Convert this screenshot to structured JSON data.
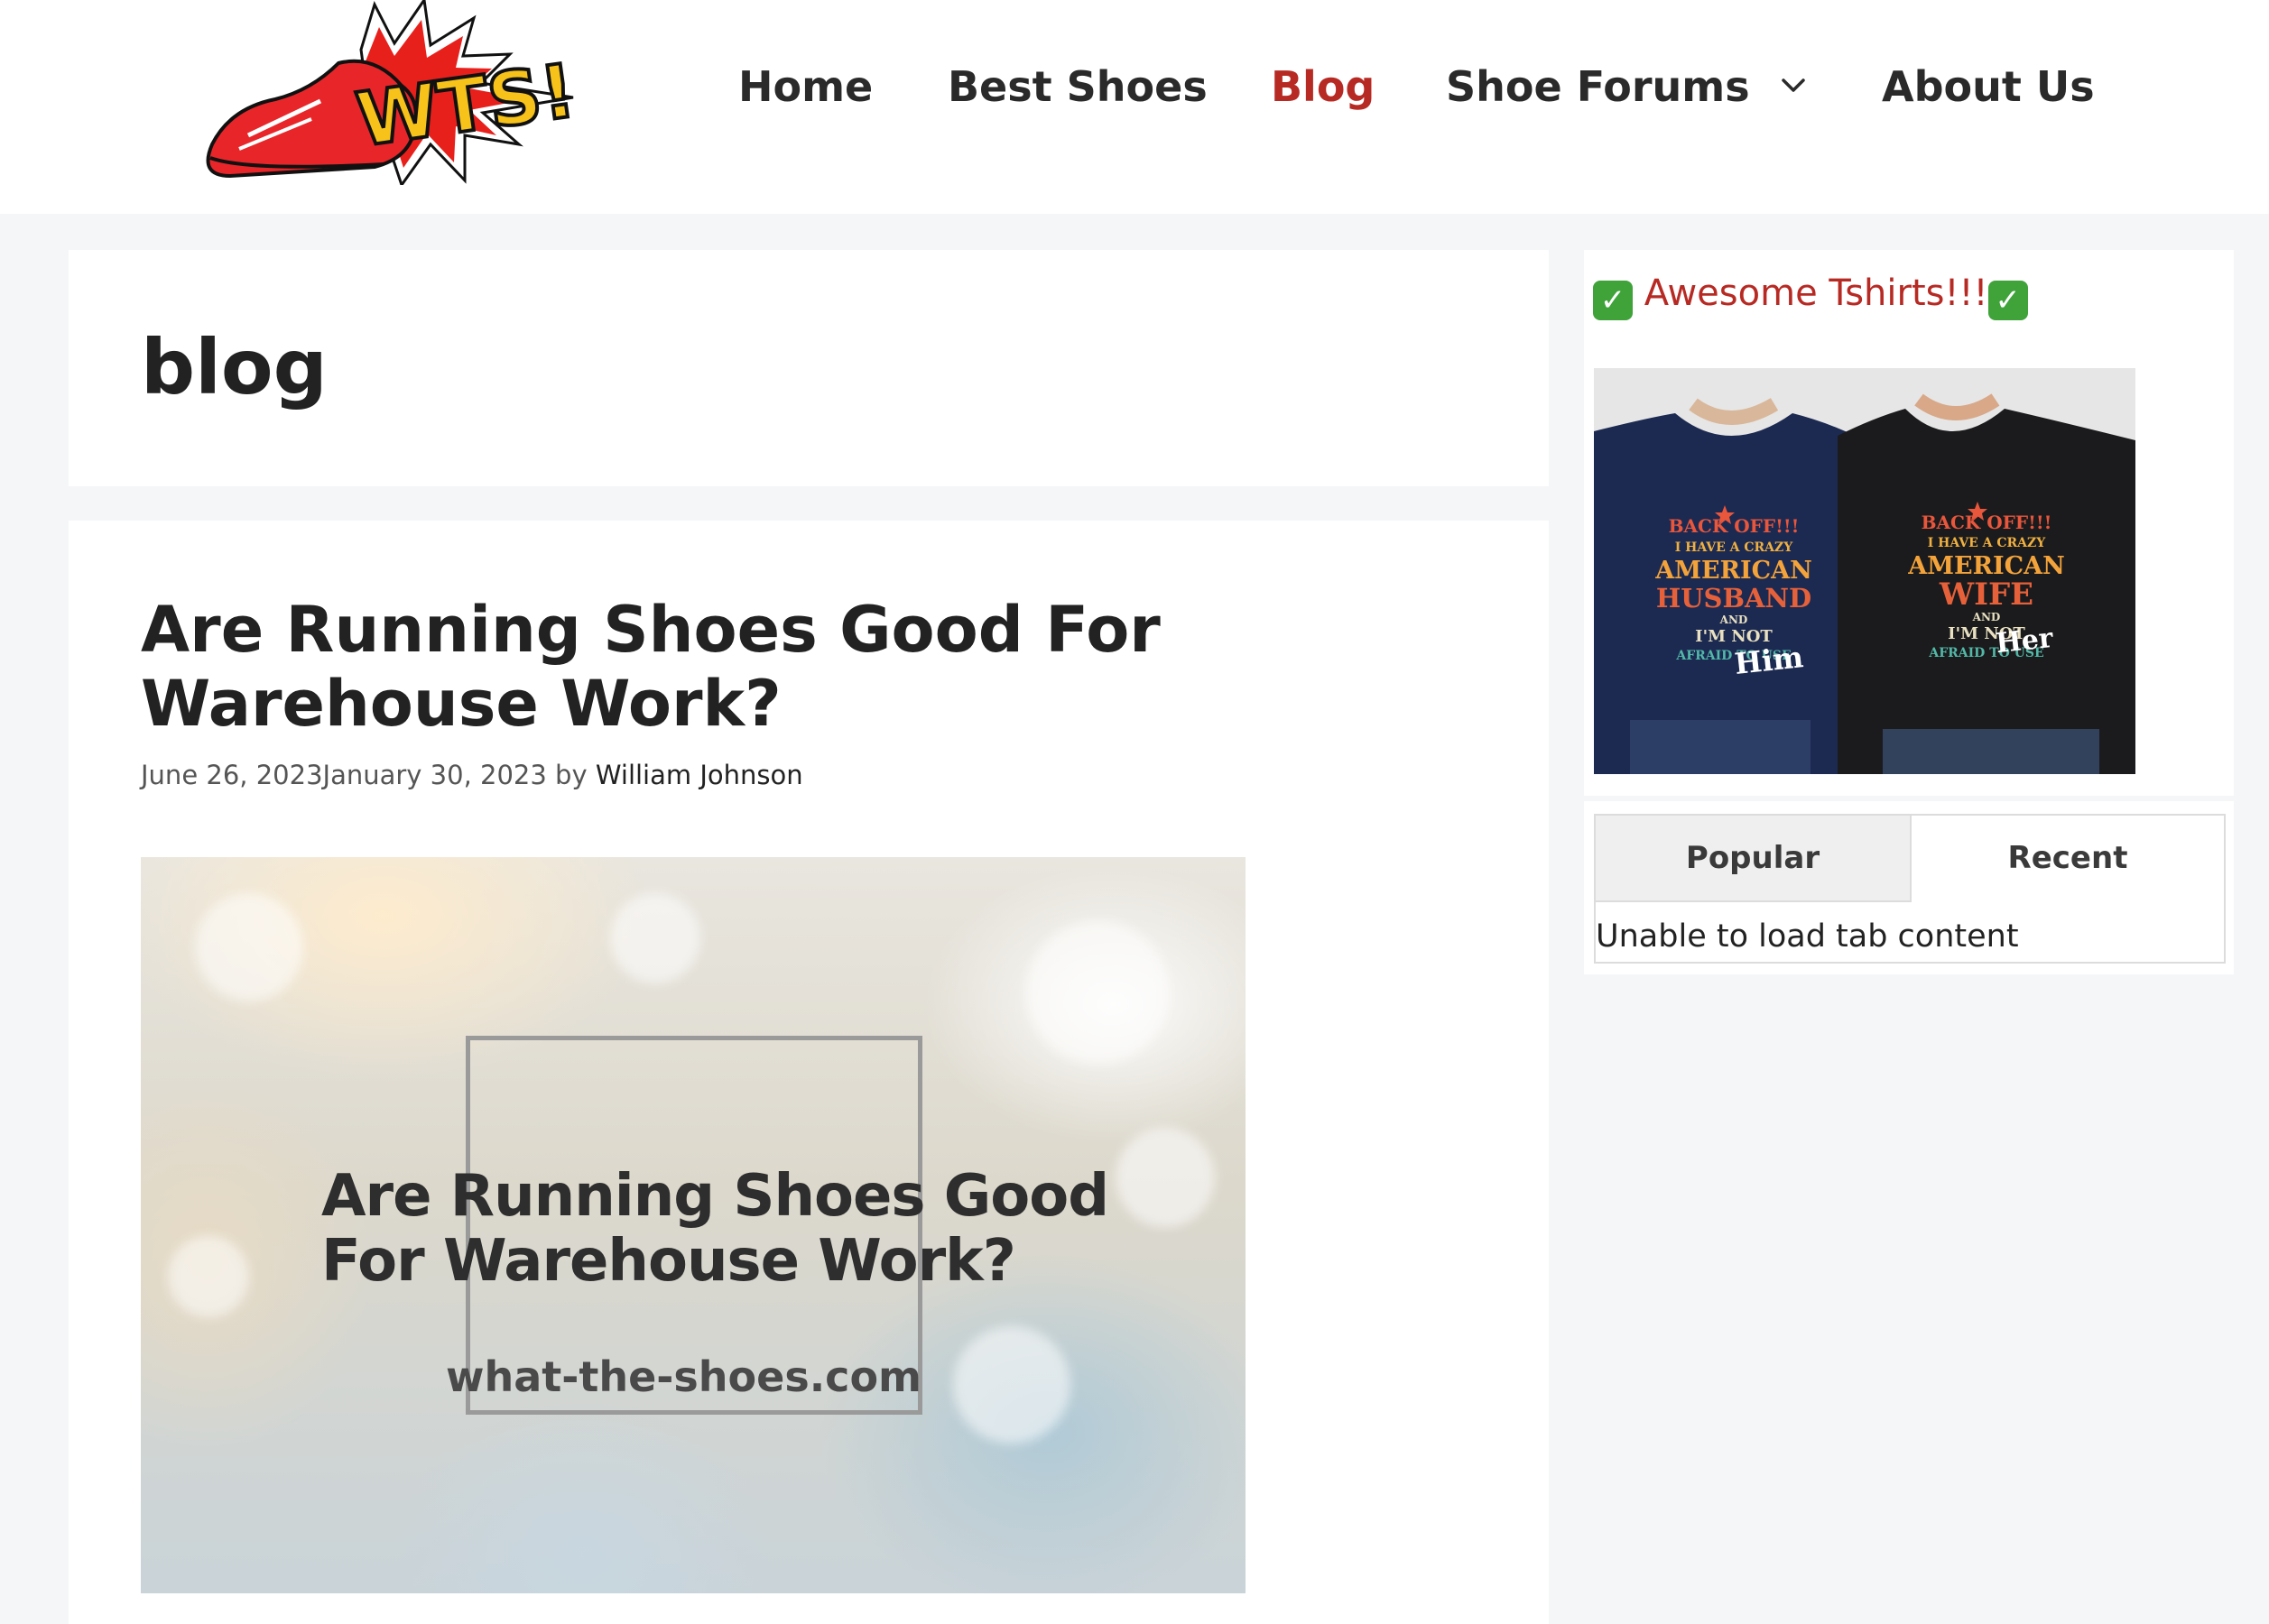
{
  "header": {
    "logo_text": "WTS!",
    "nav": [
      {
        "label": "Home"
      },
      {
        "label": "Best Shoes"
      },
      {
        "label": "Blog",
        "active": true
      },
      {
        "label": "Shoe Forums",
        "has_dropdown": true
      },
      {
        "label": "About Us"
      }
    ],
    "dropdown_icon": "chevron-down-icon"
  },
  "archive": {
    "title": "blog"
  },
  "post": {
    "title": "Are Running Shoes Good For Warehouse Work?",
    "published": "June 26, 2023",
    "updated": "January 30, 2023",
    "by": "by",
    "author": "William Johnson",
    "featured_image": {
      "headline": "Are Running Shoes Good For Warehouse Work?",
      "domain": "what-the-shoes.com"
    }
  },
  "sidebar": {
    "ad": {
      "heading": "Awesome Tshirts!!!",
      "check_icon": "check-icon",
      "shirts": [
        {
          "lines": [
            "BACK OFF!!!",
            "I HAVE A CRAZY",
            "AMERICAN",
            "HUSBAND",
            "AND",
            "I'M NOT",
            "AFRAID TO USE",
            "Him"
          ]
        },
        {
          "lines": [
            "BACK OFF!!!",
            "I HAVE A CRAZY",
            "AMERICAN",
            "WIFE",
            "AND",
            "I'M NOT",
            "AFRAID TO USE",
            "Her"
          ]
        }
      ]
    },
    "tabs": {
      "items": [
        {
          "label": "Popular",
          "active": true
        },
        {
          "label": "Recent"
        }
      ],
      "message": "Unable to load tab content"
    }
  },
  "colors": {
    "accent": "#b72a24",
    "page_bg": "#f5f6f8",
    "card_bg": "#ffffff",
    "text": "#222222"
  }
}
